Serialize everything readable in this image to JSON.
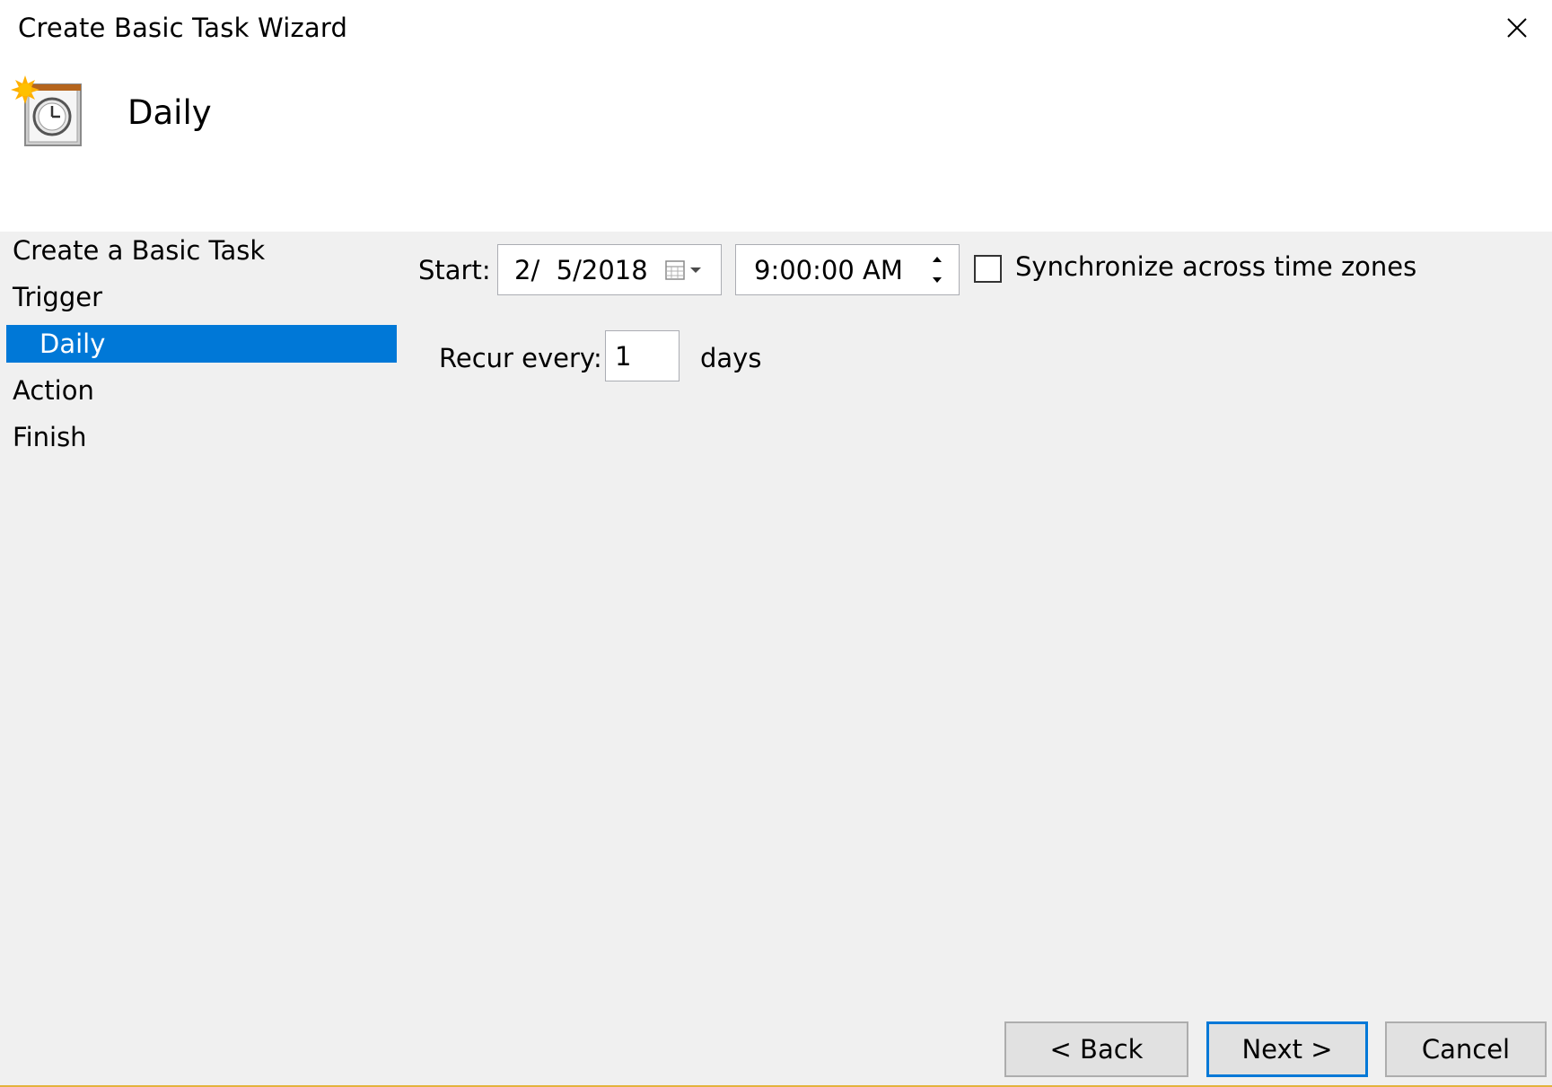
{
  "window": {
    "title": "Create Basic Task Wizard"
  },
  "header": {
    "title": "Daily",
    "icon": "scheduled-task-clock-icon"
  },
  "steps": [
    {
      "label": "Create a Basic Task",
      "active": false
    },
    {
      "label": "Trigger",
      "active": false
    },
    {
      "label": "Daily",
      "active": true
    },
    {
      "label": "Action",
      "active": false
    },
    {
      "label": "Finish",
      "active": false
    }
  ],
  "form": {
    "start_label": "Start:",
    "date_value": "2/  5/2018",
    "time_value": "9:00:00 AM",
    "sync_label": "Synchronize across time zones",
    "sync_checked": false,
    "recur_label": "Recur every:",
    "recur_value": "1",
    "recur_unit": "days"
  },
  "buttons": {
    "back": "< Back",
    "next": "Next >",
    "cancel": "Cancel"
  },
  "colors": {
    "selection": "#0078d7",
    "panel": "#f0f0f0",
    "accent_line": "#e3b23c"
  }
}
